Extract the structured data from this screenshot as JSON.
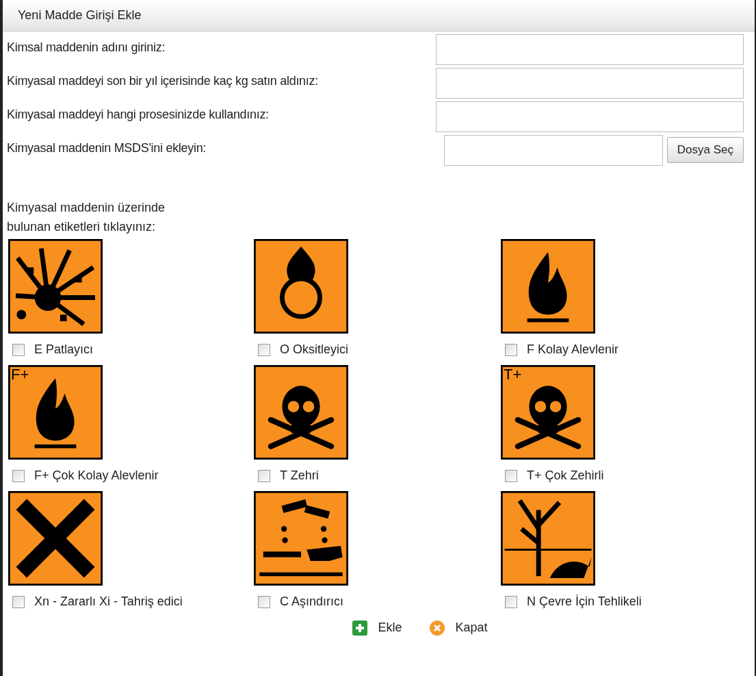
{
  "window": {
    "title": "Yeni Madde Girişi Ekle"
  },
  "fields": [
    {
      "label": "Kimsal maddenin adını giriniz:",
      "kind": "text"
    },
    {
      "label": "Kimyasal maddeyi son bir yıl içerisinde kaç kg satın aldınız:",
      "kind": "text"
    },
    {
      "label": "Kimyasal maddeyi hangi prosesinizde kullandınız:",
      "kind": "text"
    },
    {
      "label": "Kimyasal maddenin MSDS'ini ekleyin:",
      "kind": "file",
      "button": "Dosya Seç"
    }
  ],
  "labels_prompt": "Kimyasal maddenin üzerinde\nbulunan etiketleri tıklayınız:",
  "hazards": [
    {
      "kind": "explosive",
      "label": "E Patlayıcı",
      "checked": false
    },
    {
      "kind": "oxidizing",
      "label": "O Oksitleyici",
      "checked": false
    },
    {
      "kind": "flame",
      "label": "F Kolay Alevlenir",
      "checked": false
    },
    {
      "kind": "flame",
      "mark": "F+",
      "label": "F+ Çok Kolay Alevlenir",
      "checked": false
    },
    {
      "kind": "skull",
      "label": "T Zehri",
      "checked": false
    },
    {
      "kind": "skull",
      "mark": "T+",
      "label": "T+ Çok Zehirli",
      "checked": false
    },
    {
      "kind": "cross",
      "label": "Xn - Zararlı Xi - Tahriş edici",
      "checked": false
    },
    {
      "kind": "corrosive",
      "label": "C Aşındırıcı",
      "checked": false
    },
    {
      "kind": "environment",
      "label": "N Çevre İçin Tehlikeli",
      "checked": false
    }
  ],
  "actions": [
    {
      "kind": "add",
      "label": "Ekle"
    },
    {
      "kind": "close",
      "label": "Kapat"
    }
  ]
}
